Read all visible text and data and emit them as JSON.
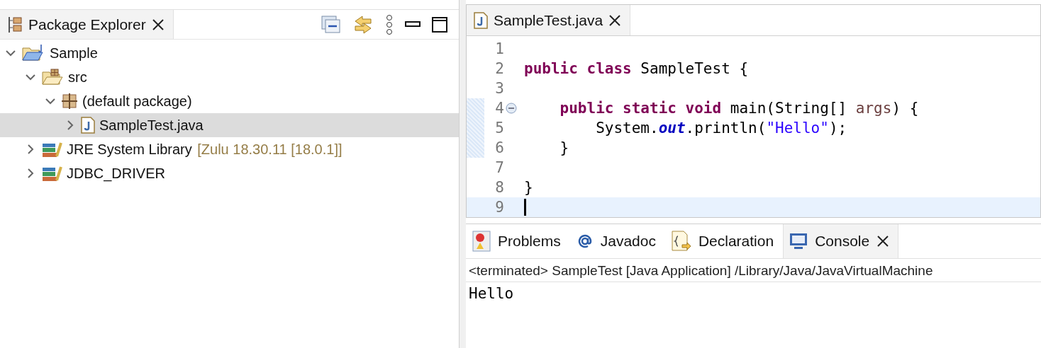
{
  "explorer": {
    "tab": {
      "label": "Package Explorer",
      "selected": true
    },
    "tree": [
      {
        "kind": "project",
        "label": "Sample",
        "expanded": true,
        "selected": false,
        "children": [
          {
            "kind": "source-folder",
            "label": "src",
            "expanded": true,
            "selected": false,
            "children": [
              {
                "kind": "package",
                "label": "(default package)",
                "expanded": true,
                "selected": false,
                "children": [
                  {
                    "kind": "java-file",
                    "label": "SampleTest.java",
                    "expanded": false,
                    "selected": true
                  }
                ]
              }
            ]
          },
          {
            "kind": "library",
            "label": "JRE System Library",
            "decoration": "[Zulu 18.30.11 [18.0.1]]",
            "expanded": false,
            "selected": false
          },
          {
            "kind": "library",
            "label": "JDBC_DRIVER",
            "expanded": false,
            "selected": false
          }
        ]
      }
    ]
  },
  "editor": {
    "tab": {
      "label": "SampleTest.java",
      "selected": true
    },
    "lines": [
      {
        "number": "1"
      },
      {
        "number": "2",
        "tokens": [
          {
            "kind": "keyword",
            "text": "public class"
          },
          {
            "kind": "plain",
            "text": " SampleTest {"
          }
        ]
      },
      {
        "number": "3"
      },
      {
        "number": "4",
        "fold": true,
        "range": true,
        "tokens": [
          {
            "kind": "keyword",
            "text": "    public static void"
          },
          {
            "kind": "plain",
            "text": " main(String[] "
          },
          {
            "kind": "param",
            "text": "args"
          },
          {
            "kind": "plain",
            "text": ") {"
          }
        ]
      },
      {
        "number": "5",
        "range": true,
        "tokens": [
          {
            "kind": "plain",
            "text": "        System."
          },
          {
            "kind": "field",
            "text": "out"
          },
          {
            "kind": "plain",
            "text": ".println("
          },
          {
            "kind": "string",
            "text": "\"Hello\""
          },
          {
            "kind": "plain",
            "text": ");"
          }
        ]
      },
      {
        "number": "6",
        "range": true,
        "tokens": [
          {
            "kind": "plain",
            "text": "    }"
          }
        ]
      },
      {
        "number": "7"
      },
      {
        "number": "8",
        "tokens": [
          {
            "kind": "plain",
            "text": "}"
          }
        ]
      },
      {
        "number": "9",
        "current": true
      }
    ]
  },
  "console": {
    "tabs": [
      {
        "kind": "problems",
        "label": "Problems",
        "selected": false
      },
      {
        "kind": "javadoc",
        "label": "Javadoc",
        "selected": false
      },
      {
        "kind": "declaration",
        "label": "Declaration",
        "selected": false
      },
      {
        "kind": "console",
        "label": "Console",
        "selected": true
      }
    ],
    "description": "<terminated> SampleTest [Java Application] /Library/Java/JavaVirtualMachine",
    "output": "Hello"
  }
}
